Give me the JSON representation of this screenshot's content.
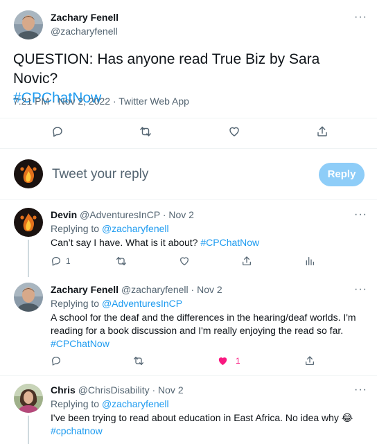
{
  "main_tweet": {
    "author_name": "Zachary Fenell",
    "author_handle": "@zacharyfenell",
    "text_plain": "QUESTION: Has anyone read True Biz by Sara Novic?",
    "hashtag": "#CPChatNow",
    "meta": "7:21 PM · Nov 2, 2022 · Twitter Web App",
    "more": "···"
  },
  "composer": {
    "placeholder": "Tweet your reply",
    "reply_label": "Reply"
  },
  "replies": [
    {
      "author_name": "Devin",
      "author_handle": "@AdventuresInCP",
      "date": "· Nov 2",
      "replying_label": "Replying to",
      "replying_to": "@zacharyfenell",
      "text_plain": "Can’t say I have. What is it about?",
      "hashtag": "#CPChatNow",
      "reply_count": "1",
      "like_count": "",
      "more": "···"
    },
    {
      "author_name": "Zachary Fenell",
      "author_handle": "@zacharyfenell",
      "date": "· Nov 2",
      "replying_label": "Replying to",
      "replying_to": "@AdventuresInCP",
      "text_line1": "A school for the deaf and the differences in the hearing/deaf worlds. I'm",
      "text_line2": "reading for a book discussion and I'm really enjoying the read so far.",
      "hashtag": "#CPChatNow",
      "like_count": "1",
      "more": "···"
    },
    {
      "author_name": "Chris",
      "author_handle": "@ChrisDisability",
      "date": "· Nov 2",
      "replying_label": "Replying to",
      "replying_to": "@zacharyfenell",
      "text_plain": "I've been trying to read about education in East Africa. No idea why",
      "emoji": "😂",
      "hashtag": "#cpchatnow",
      "more": "···"
    }
  ],
  "colors": {
    "link": "#1d9bf0",
    "muted": "#536471",
    "like_active": "#f91880",
    "reply_button_disabled": "#8ecdf8"
  }
}
